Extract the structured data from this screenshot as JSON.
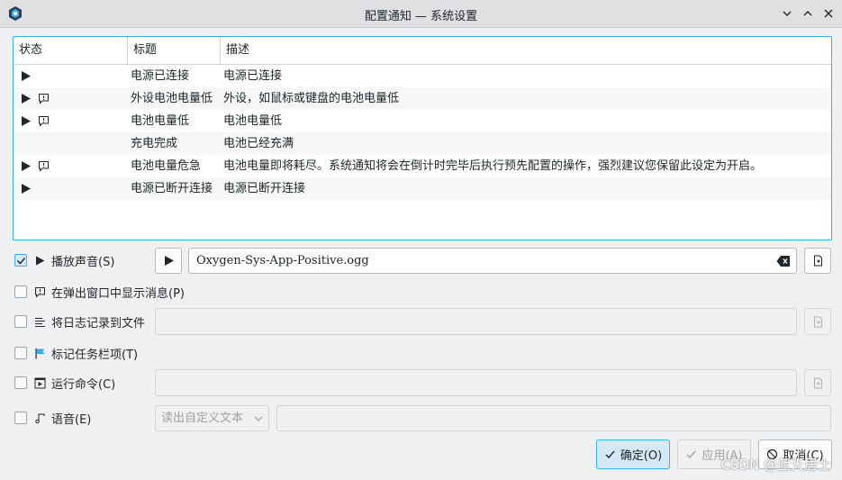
{
  "window": {
    "title": "配置通知 — 系统设置",
    "icon": "app-logo-icon"
  },
  "table": {
    "headers": [
      "状态",
      "标题",
      "描述"
    ],
    "rows": [
      {
        "play": true,
        "popup": false,
        "title": "电源已连接",
        "desc": "电源已连接"
      },
      {
        "play": true,
        "popup": true,
        "title": "外设电池电量低",
        "desc": "外设，如鼠标或键盘的电池电量低"
      },
      {
        "play": true,
        "popup": true,
        "title": "电池电量低",
        "desc": "电池电量低"
      },
      {
        "play": false,
        "popup": false,
        "title": "充电完成",
        "desc": "电池已经充满"
      },
      {
        "play": true,
        "popup": true,
        "title": "电池电量危急",
        "desc": "电池电量即将耗尽。系统通知将会在倒计时完毕后执行预先配置的操作，强烈建议您保留此设定为开启。"
      },
      {
        "play": true,
        "popup": false,
        "title": "电源已断开连接",
        "desc": "电源已断开连接"
      }
    ]
  },
  "options": {
    "play_sound": {
      "label": "播放声音(S)",
      "checked": true,
      "file": "Oxygen-Sys-App-Positive.ogg"
    },
    "popup": {
      "label": "在弹出窗口中显示消息(P)",
      "checked": false
    },
    "log": {
      "label": "将日志记录到文件",
      "checked": false,
      "value": ""
    },
    "taskbar": {
      "label": "标记任务栏项(T)",
      "checked": false
    },
    "command": {
      "label": "运行命令(C)",
      "checked": false,
      "value": ""
    },
    "speech": {
      "label": "语音(E)",
      "checked": false,
      "mode": "读出自定义文本",
      "text": ""
    }
  },
  "buttons": {
    "ok": "确定(O)",
    "apply": "应用(A)",
    "cancel": "取消(C)"
  },
  "watermark": "CSDN @蓝天居士",
  "colors": {
    "accent": "#3daee9",
    "titlebar": "#dee0e2",
    "background": "#eff0f1"
  }
}
